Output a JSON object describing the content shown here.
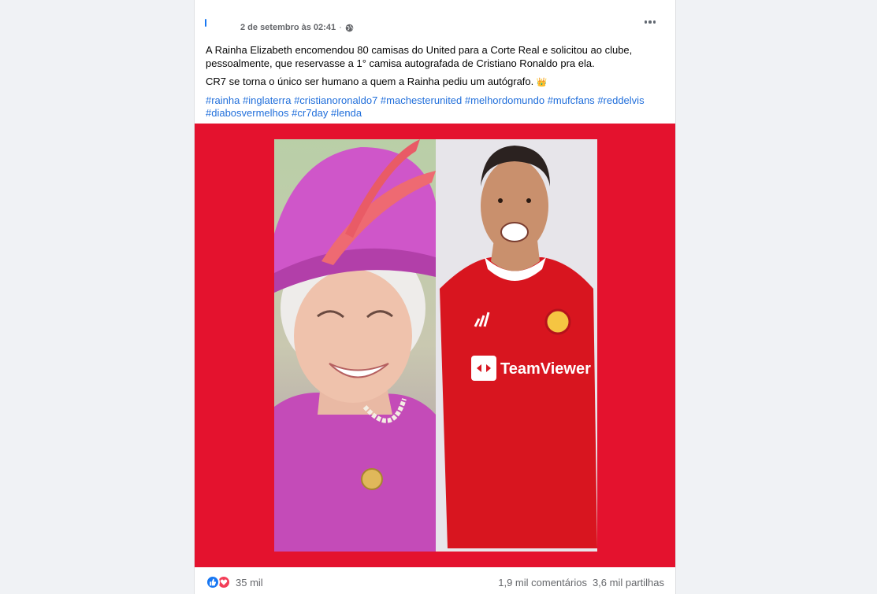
{
  "post": {
    "timestamp": "2 de setembro às 02:41",
    "separator": "·",
    "privacy_icon": "globe-icon",
    "more_icon": "more-horizontal-icon",
    "text_paragraph_1": "A Rainha Elizabeth encomendou 80 camisas do United para a Corte Real e solicitou ao clube, pessoalmente, que reservasse a 1° camisa autografada de Cristiano Ronaldo pra ela.",
    "text_paragraph_2": "CR7 se torna o único ser humano a quem a Rainha pediu um autógrafo.",
    "emoji": "👑",
    "hashtags": [
      "#rainha",
      "#inglaterra",
      "#cristianoronaldo7",
      "#machesterunited",
      "#melhordomundo",
      "#mufcfans",
      "#reddelvis",
      "#diabosvermelhos",
      "#cr7day",
      "#lenda"
    ],
    "image": {
      "left_subject": "queen-elizabeth-photo",
      "right_subject": "cristiano-ronaldo-photo",
      "jersey_sponsor": "TeamViewer",
      "colors": {
        "background": "#e4122e",
        "hat": "#d453c8",
        "jersey": "#d8151f"
      }
    }
  },
  "footer": {
    "reaction_icons": [
      "like-icon",
      "love-icon"
    ],
    "reaction_count": "35 mil",
    "comments": "1,9 mil comentários",
    "shares": "3,6 mil partilhas"
  }
}
